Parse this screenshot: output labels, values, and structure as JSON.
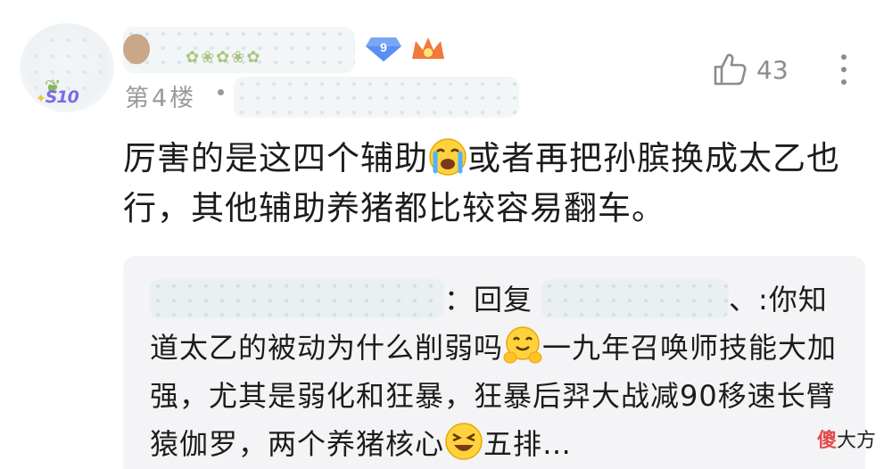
{
  "post": {
    "floor_label": "第4楼",
    "separator": "•",
    "level_badge": "9",
    "like_count": "43",
    "comment_part1": "厉害的是这四个辅助",
    "comment_part2": "或者再把孙膑换成太乙也行，其他辅助养猪都比较容易翻车。"
  },
  "reply": {
    "colon1": "：",
    "reply_word": "回复",
    "quote_start": "、:你知道太乙的被动为什么削弱吗",
    "part2": "一九年召唤师技能大加强，尤其是弱化和狂暴，狂暴后羿大战减90移速长臂猿伽罗，两个养猪核心",
    "part3": "五排…"
  },
  "avatar_badge": "S10",
  "watermark": {
    "icon_char": "傻",
    "text": "大方"
  },
  "colors": {
    "text": "#1c1c1c",
    "muted": "#9a9a9a",
    "reply_bg": "#f4f4f6",
    "badge_blue": "#5a8ef2",
    "crown_orange": "#f07a3a"
  }
}
